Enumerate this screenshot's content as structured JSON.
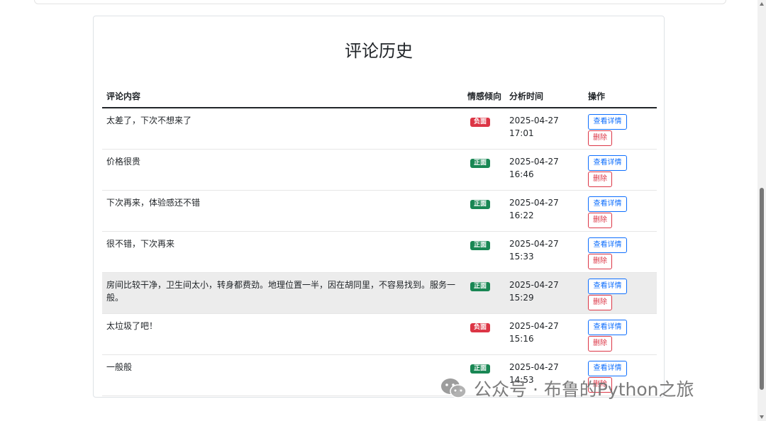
{
  "page": {
    "title": "评论历史"
  },
  "table": {
    "headers": {
      "comment": "评论内容",
      "sentiment": "情感倾向",
      "time": "分析时间",
      "actions": "操作"
    },
    "rows": [
      {
        "comment": "太差了，下次不想来了",
        "sentiment": "负面",
        "date": "2025-04-27",
        "time": "17:01"
      },
      {
        "comment": "价格很贵",
        "sentiment": "正面",
        "date": "2025-04-27",
        "time": "16:46"
      },
      {
        "comment": "下次再来，体验感还不错",
        "sentiment": "正面",
        "date": "2025-04-27",
        "time": "16:22"
      },
      {
        "comment": "很不错，下次再来",
        "sentiment": "正面",
        "date": "2025-04-27",
        "time": "15:33"
      },
      {
        "comment": "房间比较干净，卫生间太小，转身都费劲。地理位置一半，因在胡同里，不容易找到。服务一般。",
        "sentiment": "正面",
        "date": "2025-04-27",
        "time": "15:29"
      },
      {
        "comment": "太垃圾了吧！",
        "sentiment": "负面",
        "date": "2025-04-27",
        "time": "15:16"
      },
      {
        "comment": "一般般",
        "sentiment": "正面",
        "date": "2025-04-27",
        "time": "14:53"
      }
    ]
  },
  "actions": {
    "view_label": "查看详情",
    "delete_label": "删除"
  },
  "colors": {
    "negative": "#dc3545",
    "positive": "#198754",
    "primary": "#0d6efd"
  },
  "watermark": {
    "text": "公众号 · 布鲁的Python之旅",
    "icon": "wechat-icon"
  }
}
